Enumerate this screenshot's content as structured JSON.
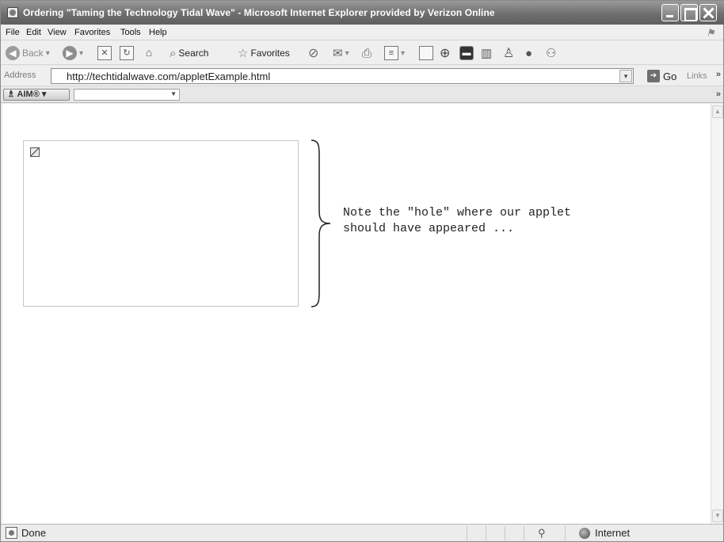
{
  "window": {
    "title": "Ordering \"Taming the Technology Tidal Wave\" - Microsoft Internet Explorer provided by Verizon Online"
  },
  "menu": {
    "items": [
      "File",
      "Edit",
      "View",
      "Favorites",
      "Tools",
      "Help"
    ]
  },
  "toolbar": {
    "back_label": "Back",
    "search_label": "Search",
    "favorites_label": "Favorites"
  },
  "address": {
    "label": "Address",
    "url": "http://techtidalwave.com/appletExample.html",
    "go_label": "Go",
    "links_label": "Links"
  },
  "aim": {
    "label": "AIM"
  },
  "content": {
    "note": "Note the \"hole\" where our applet\nshould have appeared ..."
  },
  "status": {
    "text": "Done",
    "zone": "Internet"
  },
  "icons": {
    "app": "ie-page-icon",
    "back": "back-arrow-icon",
    "forward": "forward-arrow-icon",
    "stop": "stop-icon",
    "refresh": "refresh-icon",
    "home": "home-icon",
    "search": "search-icon",
    "favorites": "favorites-star-icon",
    "history": "history-icon",
    "mail": "mail-icon",
    "print": "print-icon",
    "edit": "edit-icon",
    "discuss": "discuss-icon",
    "go": "go-arrow-icon",
    "broken_image": "broken-image-icon",
    "zone": "internet-zone-icon"
  }
}
